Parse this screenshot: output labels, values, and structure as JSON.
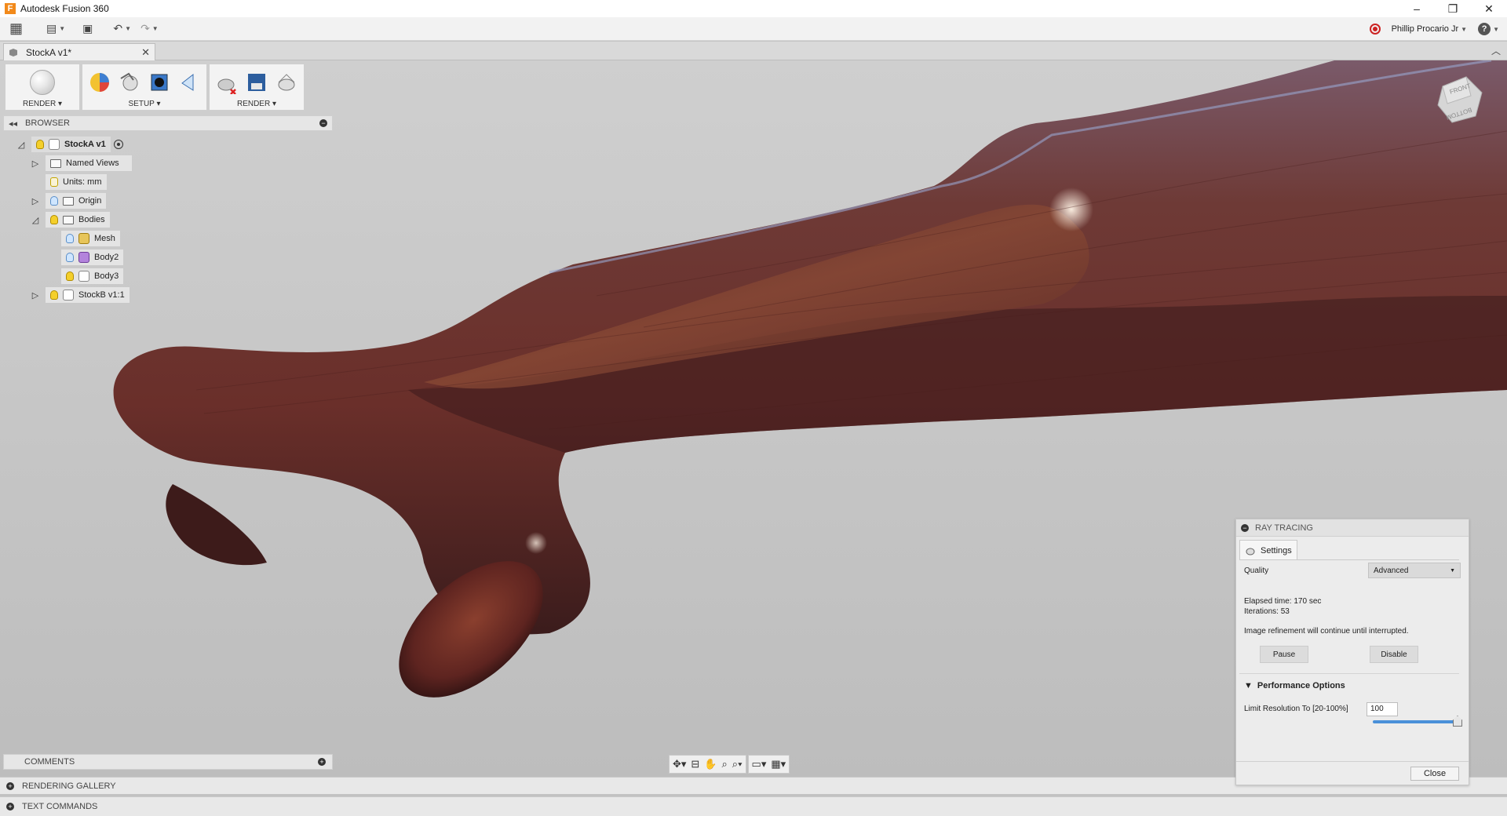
{
  "app": {
    "title": "Autodesk Fusion 360",
    "icon_letter": "F"
  },
  "window_controls": {
    "minimize": "–",
    "restore": "❐",
    "close": "✕"
  },
  "qat": {
    "grid": "▦",
    "file": "▤",
    "save": "▣",
    "undo": "↶",
    "redo": "↷"
  },
  "user": {
    "name": "Phillip Procario Jr",
    "help": "?"
  },
  "tab": {
    "name": "StockA v1*",
    "close": "✕"
  },
  "toolbar": {
    "workspace_label": "RENDER",
    "setup_label": "SETUP",
    "render_label": "RENDER"
  },
  "browser": {
    "title": "BROWSER",
    "root": "StockA v1",
    "items": [
      {
        "label": "Named Views"
      },
      {
        "label": "Units: mm"
      },
      {
        "label": "Origin"
      },
      {
        "label": "Bodies"
      },
      {
        "label": "Mesh"
      },
      {
        "label": "Body2"
      },
      {
        "label": "Body3"
      },
      {
        "label": "StockB v1:1"
      }
    ]
  },
  "viewcube": {
    "front": "FRONT",
    "bottom": "BOTTOM"
  },
  "comments": {
    "label": "COMMENTS"
  },
  "bottom": {
    "gallery": "RENDERING GALLERY",
    "text_commands": "TEXT COMMANDS"
  },
  "ray_tracing": {
    "title": "RAY TRACING",
    "tab": "Settings",
    "quality_label": "Quality",
    "quality_value": "Advanced",
    "elapsed": "Elapsed time: 170 sec",
    "iterations": "Iterations: 53",
    "refinement": "Image refinement will continue until interrupted.",
    "pause": "Pause",
    "disable": "Disable",
    "perf_title": "Performance Options",
    "limit_label": "Limit Resolution To [20-100%]",
    "limit_value": "100",
    "limit_fraction": 1.0,
    "close": "Close"
  },
  "colors": {
    "wood": "#6a2f2a",
    "accent": "#4a90d9",
    "bulb_on": "#f4cf2b",
    "bulb_off": "#cfe6ff"
  }
}
